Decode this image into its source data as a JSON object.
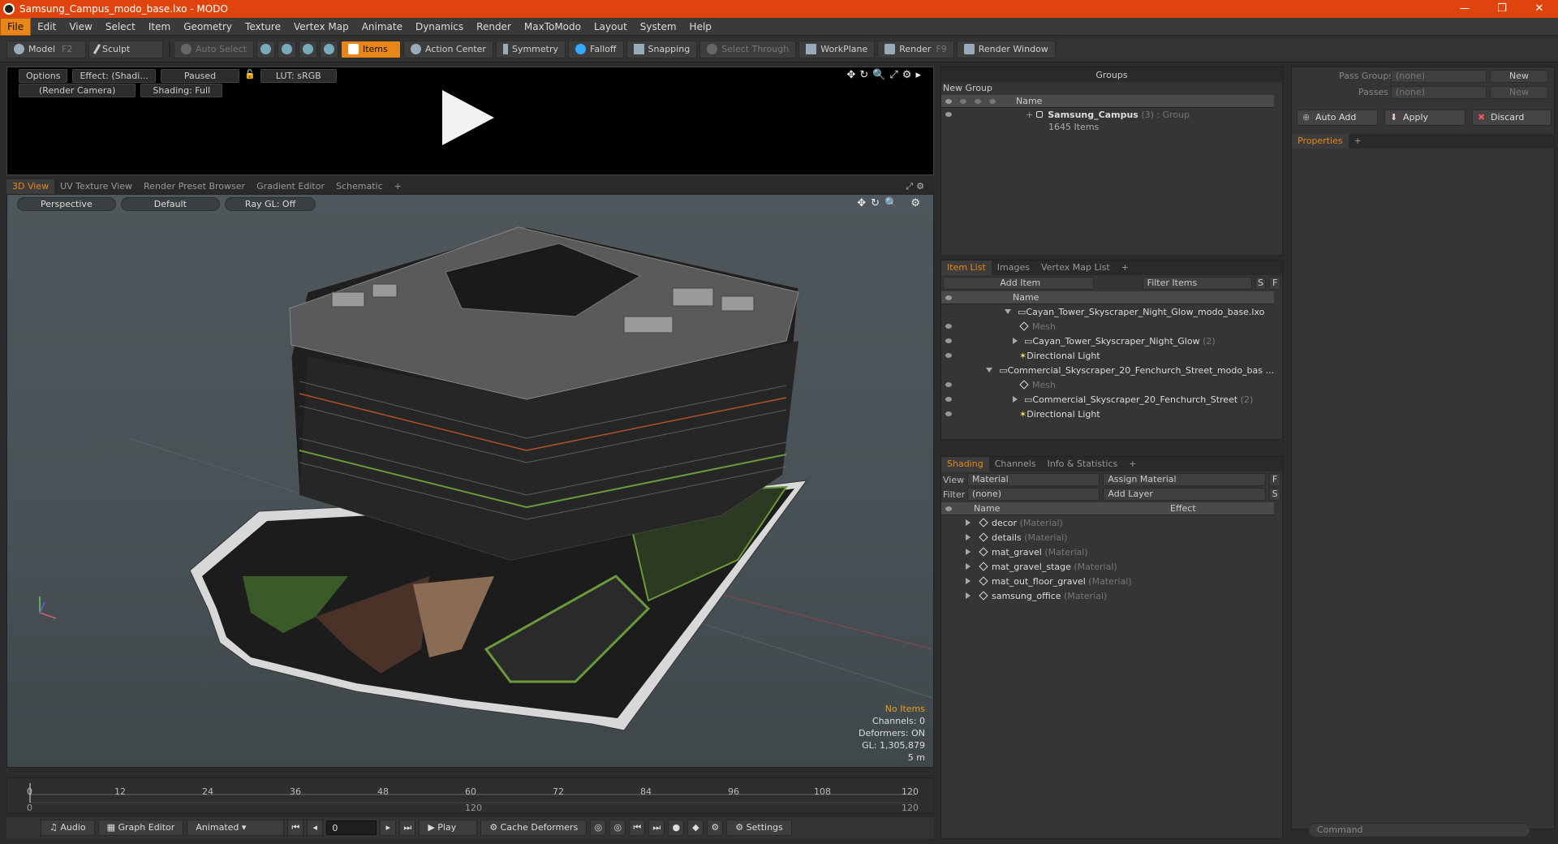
{
  "window": {
    "title": "Samsung_Campus_modo_base.lxo - MODO",
    "controls": [
      "—",
      "❐",
      "✕"
    ]
  },
  "menu": [
    "File",
    "Edit",
    "View",
    "Select",
    "Item",
    "Geometry",
    "Texture",
    "Vertex Map",
    "Animate",
    "Dynamics",
    "Render",
    "MaxToModo",
    "Layout",
    "System",
    "Help"
  ],
  "toolbar": {
    "model": "Model",
    "model_key": "F2",
    "sculpt": "Sculpt",
    "auto_select": "Auto Select",
    "items": "Items",
    "action_center": "Action Center",
    "symmetry": "Symmetry",
    "falloff": "Falloff",
    "snapping": "Snapping",
    "select_through": "Select Through",
    "workplane": "WorkPlane",
    "render": "Render",
    "render_key": "F9",
    "render_window": "Render Window"
  },
  "preview": {
    "options": "Options",
    "effect": "Effect: (Shadi...",
    "paused": "Paused",
    "lut": "LUT: sRGB",
    "camera": "(Render Camera)",
    "shading": "Shading: Full"
  },
  "viewport_tabs": [
    "3D View",
    "UV Texture View",
    "Render Preset Browser",
    "Gradient Editor",
    "Schematic",
    "+"
  ],
  "viewport": {
    "perspective": "Perspective",
    "default": "Default",
    "raygl": "Ray GL: Off"
  },
  "stats": {
    "no_items": "No Items",
    "channels": "Channels: 0",
    "deformers": "Deformers: ON",
    "gl": "GL: 1,305,879",
    "scale": "5 m"
  },
  "timeline": {
    "ticks": [
      "0",
      "12",
      "24",
      "36",
      "48",
      "60",
      "72",
      "84",
      "96",
      "108",
      "120"
    ],
    "start": "0",
    "mid": "120",
    "end": "120"
  },
  "transport": {
    "audio": "Audio",
    "graph_editor": "Graph Editor",
    "animated": "Animated",
    "frame": "0",
    "play": "Play",
    "cache": "Cache Deformers",
    "settings": "Settings"
  },
  "groups": {
    "title": "Groups",
    "new_group": "New Group",
    "col_name": "Name",
    "item_name": "Samsung_Campus",
    "item_count": "(3)",
    "item_type": ": Group",
    "item_sub": "1645 Items"
  },
  "pass_groups": {
    "label1": "Pass Groups",
    "val1": "(none)",
    "new1": "New",
    "label2": "Passes",
    "val2": "(none)",
    "new2": "New"
  },
  "actions": {
    "auto_add": "Auto Add",
    "apply": "Apply",
    "discard": "Discard"
  },
  "properties": {
    "tab": "Properties",
    "plus": "+"
  },
  "itemlist": {
    "tabs": [
      "Item List",
      "Images",
      "Vertex Map List",
      "+"
    ],
    "add_item": "Add Item",
    "filter": "Filter Items",
    "s": "S",
    "f": "F",
    "col_name": "Name",
    "rows": [
      {
        "text": "Cayan_Tower_Skyscraper_Night_Glow_modo_base.lxo",
        "extra": "",
        "dim": false
      },
      {
        "text": "Mesh",
        "extra": "",
        "dim": true
      },
      {
        "text": "Cayan_Tower_Skyscraper_Night_Glow",
        "extra": "(2)",
        "dim": false
      },
      {
        "text": "Directional Light",
        "extra": "",
        "dim": false
      },
      {
        "text": "Commercial_Skyscraper_20_Fenchurch_Street_modo_bas ...",
        "extra": "",
        "dim": false
      },
      {
        "text": "Mesh",
        "extra": "",
        "dim": true
      },
      {
        "text": "Commercial_Skyscraper_20_Fenchurch_Street",
        "extra": "(2)",
        "dim": false
      },
      {
        "text": "Directional Light",
        "extra": "",
        "dim": false
      }
    ]
  },
  "shading": {
    "tabs": [
      "Shading",
      "Channels",
      "Info & Statistics",
      "+"
    ],
    "view_label": "View",
    "view_val": "Material",
    "assign": "Assign Material",
    "f": "F",
    "filter_label": "Filter",
    "filter_val": "(none)",
    "add_layer": "Add Layer",
    "s": "S",
    "col_name": "Name",
    "col_effect": "Effect",
    "rows": [
      {
        "name": "decor",
        "type": "(Material)"
      },
      {
        "name": "details",
        "type": "(Material)"
      },
      {
        "name": "mat_gravel",
        "type": "(Material)"
      },
      {
        "name": "mat_gravel_stage",
        "type": "(Material)"
      },
      {
        "name": "mat_out_floor_gravel",
        "type": "(Material)"
      },
      {
        "name": "samsung_office",
        "type": "(Material)"
      }
    ]
  },
  "command": {
    "placeholder": "Command"
  }
}
